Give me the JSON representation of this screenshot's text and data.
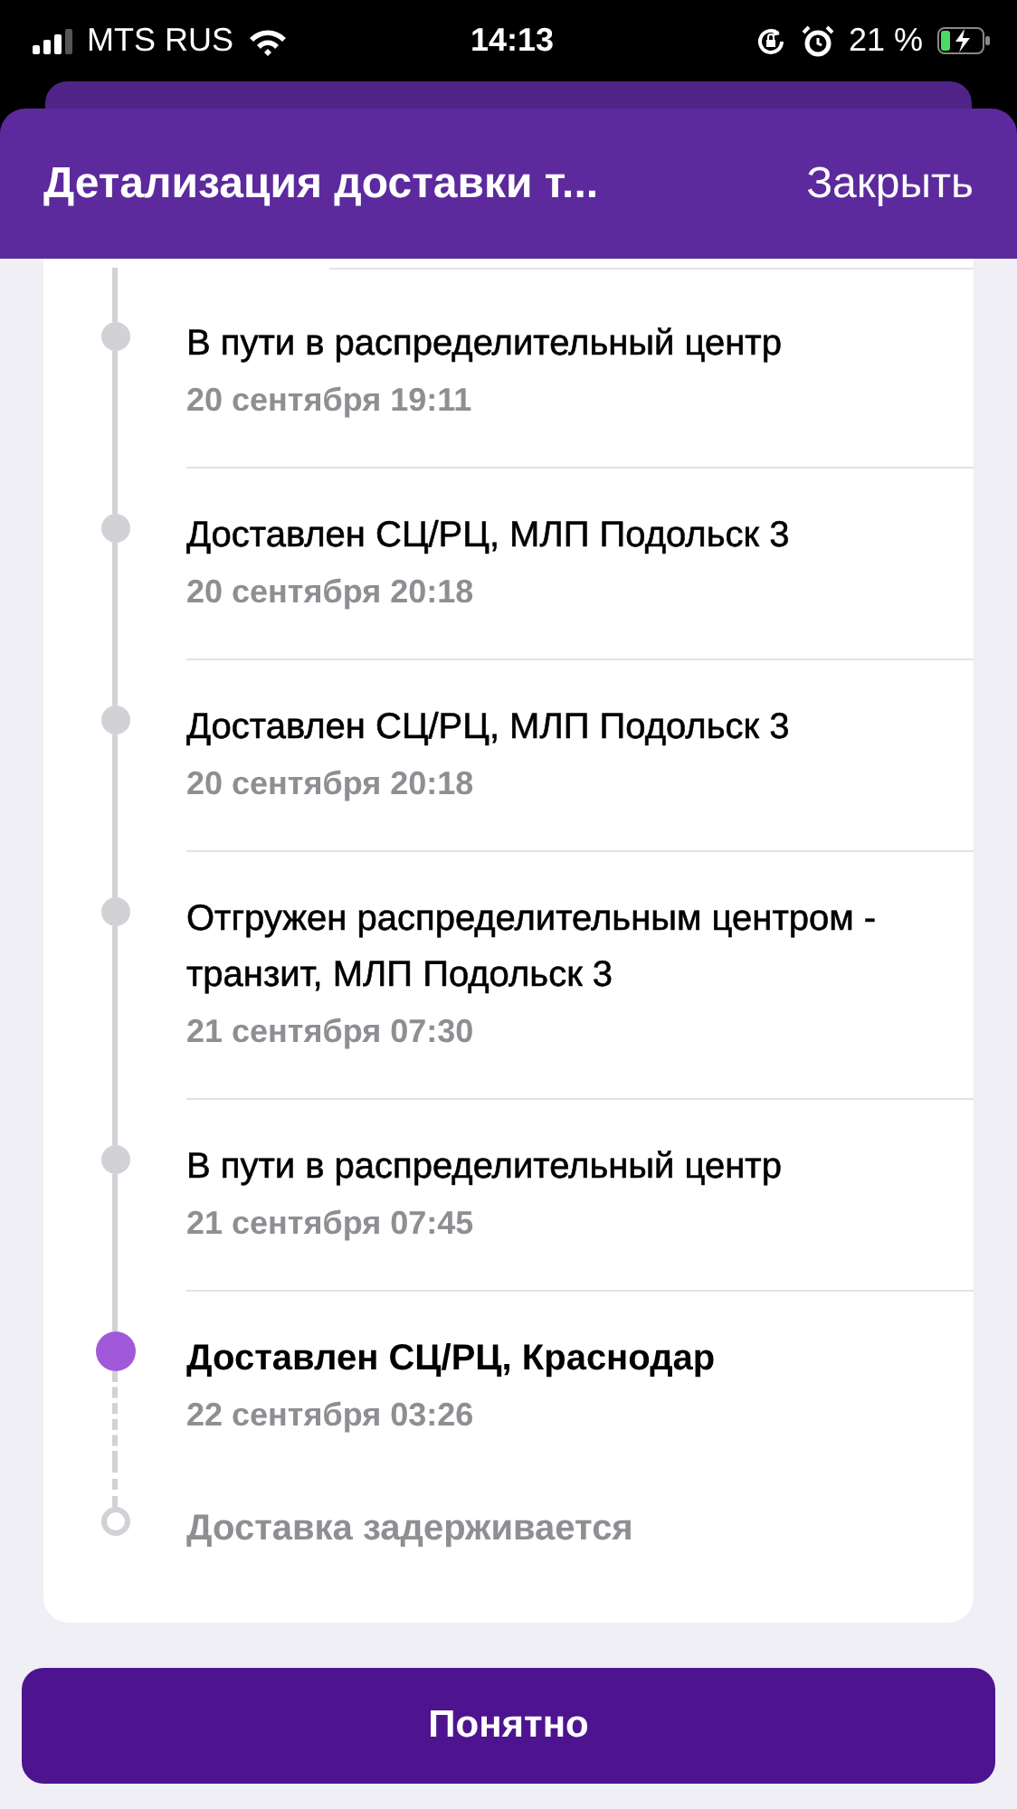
{
  "status_bar": {
    "carrier": "MTS RUS",
    "time": "14:13",
    "battery": "21 %"
  },
  "header": {
    "title": "Детализация доставки т...",
    "close": "Закрыть"
  },
  "events": [
    {
      "kind": "past",
      "title": "В пути в распределительный центр",
      "date": "20 сентября 19:11"
    },
    {
      "kind": "past",
      "title": "Доставлен СЦ/РЦ, МЛП Подольск 3",
      "date": "20 сентября 20:18"
    },
    {
      "kind": "past",
      "title": "Доставлен СЦ/РЦ, МЛП Подольск 3",
      "date": "20 сентября 20:18"
    },
    {
      "kind": "past",
      "title": "Отгружен распределительным центром - транзит, МЛП Подольск 3",
      "date": "21 сентября 07:30"
    },
    {
      "kind": "past",
      "title": "В пути в распределительный центр",
      "date": "21 сентября 07:45"
    },
    {
      "kind": "current",
      "title": "Доставлен СЦ/РЦ, Краснодар",
      "date": "22 сентября 03:26"
    },
    {
      "kind": "pending",
      "title": "Доставка задерживается"
    }
  ],
  "button": "Понятно"
}
